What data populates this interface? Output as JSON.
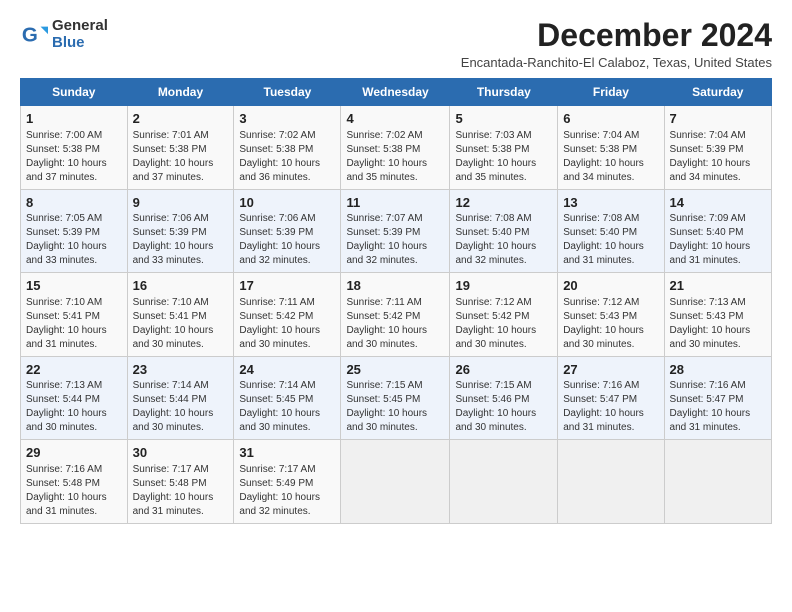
{
  "logo": {
    "general": "General",
    "blue": "Blue"
  },
  "title": "December 2024",
  "subtitle": "Encantada-Ranchito-El Calaboz, Texas, United States",
  "days_of_week": [
    "Sunday",
    "Monday",
    "Tuesday",
    "Wednesday",
    "Thursday",
    "Friday",
    "Saturday"
  ],
  "weeks": [
    [
      {
        "day": "1",
        "info": "Sunrise: 7:00 AM\nSunset: 5:38 PM\nDaylight: 10 hours\nand 37 minutes."
      },
      {
        "day": "2",
        "info": "Sunrise: 7:01 AM\nSunset: 5:38 PM\nDaylight: 10 hours\nand 37 minutes."
      },
      {
        "day": "3",
        "info": "Sunrise: 7:02 AM\nSunset: 5:38 PM\nDaylight: 10 hours\nand 36 minutes."
      },
      {
        "day": "4",
        "info": "Sunrise: 7:02 AM\nSunset: 5:38 PM\nDaylight: 10 hours\nand 35 minutes."
      },
      {
        "day": "5",
        "info": "Sunrise: 7:03 AM\nSunset: 5:38 PM\nDaylight: 10 hours\nand 35 minutes."
      },
      {
        "day": "6",
        "info": "Sunrise: 7:04 AM\nSunset: 5:38 PM\nDaylight: 10 hours\nand 34 minutes."
      },
      {
        "day": "7",
        "info": "Sunrise: 7:04 AM\nSunset: 5:39 PM\nDaylight: 10 hours\nand 34 minutes."
      }
    ],
    [
      {
        "day": "8",
        "info": "Sunrise: 7:05 AM\nSunset: 5:39 PM\nDaylight: 10 hours\nand 33 minutes."
      },
      {
        "day": "9",
        "info": "Sunrise: 7:06 AM\nSunset: 5:39 PM\nDaylight: 10 hours\nand 33 minutes."
      },
      {
        "day": "10",
        "info": "Sunrise: 7:06 AM\nSunset: 5:39 PM\nDaylight: 10 hours\nand 32 minutes."
      },
      {
        "day": "11",
        "info": "Sunrise: 7:07 AM\nSunset: 5:39 PM\nDaylight: 10 hours\nand 32 minutes."
      },
      {
        "day": "12",
        "info": "Sunrise: 7:08 AM\nSunset: 5:40 PM\nDaylight: 10 hours\nand 32 minutes."
      },
      {
        "day": "13",
        "info": "Sunrise: 7:08 AM\nSunset: 5:40 PM\nDaylight: 10 hours\nand 31 minutes."
      },
      {
        "day": "14",
        "info": "Sunrise: 7:09 AM\nSunset: 5:40 PM\nDaylight: 10 hours\nand 31 minutes."
      }
    ],
    [
      {
        "day": "15",
        "info": "Sunrise: 7:10 AM\nSunset: 5:41 PM\nDaylight: 10 hours\nand 31 minutes."
      },
      {
        "day": "16",
        "info": "Sunrise: 7:10 AM\nSunset: 5:41 PM\nDaylight: 10 hours\nand 30 minutes."
      },
      {
        "day": "17",
        "info": "Sunrise: 7:11 AM\nSunset: 5:42 PM\nDaylight: 10 hours\nand 30 minutes."
      },
      {
        "day": "18",
        "info": "Sunrise: 7:11 AM\nSunset: 5:42 PM\nDaylight: 10 hours\nand 30 minutes."
      },
      {
        "day": "19",
        "info": "Sunrise: 7:12 AM\nSunset: 5:42 PM\nDaylight: 10 hours\nand 30 minutes."
      },
      {
        "day": "20",
        "info": "Sunrise: 7:12 AM\nSunset: 5:43 PM\nDaylight: 10 hours\nand 30 minutes."
      },
      {
        "day": "21",
        "info": "Sunrise: 7:13 AM\nSunset: 5:43 PM\nDaylight: 10 hours\nand 30 minutes."
      }
    ],
    [
      {
        "day": "22",
        "info": "Sunrise: 7:13 AM\nSunset: 5:44 PM\nDaylight: 10 hours\nand 30 minutes."
      },
      {
        "day": "23",
        "info": "Sunrise: 7:14 AM\nSunset: 5:44 PM\nDaylight: 10 hours\nand 30 minutes."
      },
      {
        "day": "24",
        "info": "Sunrise: 7:14 AM\nSunset: 5:45 PM\nDaylight: 10 hours\nand 30 minutes."
      },
      {
        "day": "25",
        "info": "Sunrise: 7:15 AM\nSunset: 5:45 PM\nDaylight: 10 hours\nand 30 minutes."
      },
      {
        "day": "26",
        "info": "Sunrise: 7:15 AM\nSunset: 5:46 PM\nDaylight: 10 hours\nand 30 minutes."
      },
      {
        "day": "27",
        "info": "Sunrise: 7:16 AM\nSunset: 5:47 PM\nDaylight: 10 hours\nand 31 minutes."
      },
      {
        "day": "28",
        "info": "Sunrise: 7:16 AM\nSunset: 5:47 PM\nDaylight: 10 hours\nand 31 minutes."
      }
    ],
    [
      {
        "day": "29",
        "info": "Sunrise: 7:16 AM\nSunset: 5:48 PM\nDaylight: 10 hours\nand 31 minutes."
      },
      {
        "day": "30",
        "info": "Sunrise: 7:17 AM\nSunset: 5:48 PM\nDaylight: 10 hours\nand 31 minutes."
      },
      {
        "day": "31",
        "info": "Sunrise: 7:17 AM\nSunset: 5:49 PM\nDaylight: 10 hours\nand 32 minutes."
      },
      {
        "day": "",
        "info": ""
      },
      {
        "day": "",
        "info": ""
      },
      {
        "day": "",
        "info": ""
      },
      {
        "day": "",
        "info": ""
      }
    ]
  ]
}
